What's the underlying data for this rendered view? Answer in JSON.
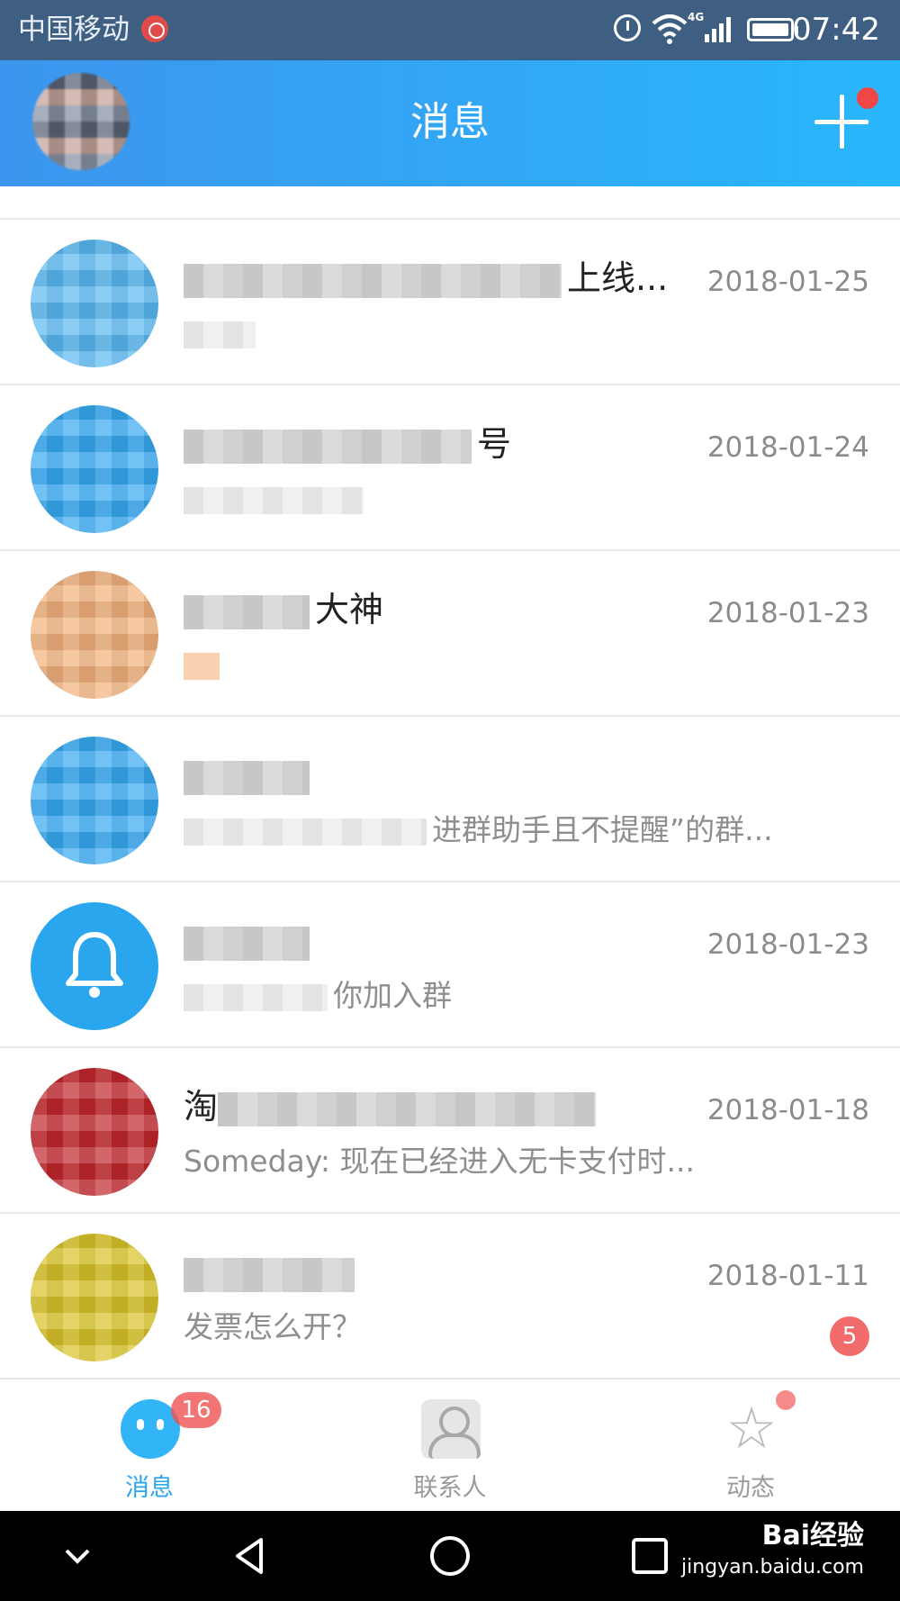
{
  "status_bar": {
    "carrier": "中国移动",
    "network": "4G",
    "time": "07:42"
  },
  "header": {
    "title": "消息"
  },
  "conversations": [
    {
      "title": "上线...",
      "subtitle": "",
      "date": "2018-01-25",
      "avatar_color": "#5ab8f1"
    },
    {
      "title": "号",
      "subtitle": "",
      "date": "2018-01-24",
      "avatar_color": "#37a9f2"
    },
    {
      "title": "大神",
      "subtitle": "",
      "date": "2018-01-23",
      "avatar_color": "#f1b17c"
    },
    {
      "title": "",
      "subtitle": "进群助手且不提醒”的群...",
      "date": "",
      "avatar_color": "#37a9f2"
    },
    {
      "title": "",
      "subtitle": "你加入群",
      "date": "2018-01-23",
      "avatar_color": "#2aa6ee"
    },
    {
      "title": "淘",
      "subtitle": "Someday: 现在已经进入无卡支付时...",
      "date": "2018-01-18",
      "avatar_color": "#c0262b"
    },
    {
      "title": "",
      "subtitle": "发票怎么开？",
      "date": "2018-01-11",
      "avatar_color": "#d9c328",
      "unread": "5"
    }
  ],
  "tabs": [
    {
      "label": "消息",
      "badge": "16",
      "active": true
    },
    {
      "label": "联系人"
    },
    {
      "label": "动态"
    }
  ],
  "watermark": {
    "brand": "Bai经验",
    "url": "jingyan.baidu.com"
  },
  "colors": {
    "header_start": "#3c95ee",
    "header_end": "#29b7fb",
    "accent": "#2aa6ee",
    "badge": "#f05252"
  }
}
